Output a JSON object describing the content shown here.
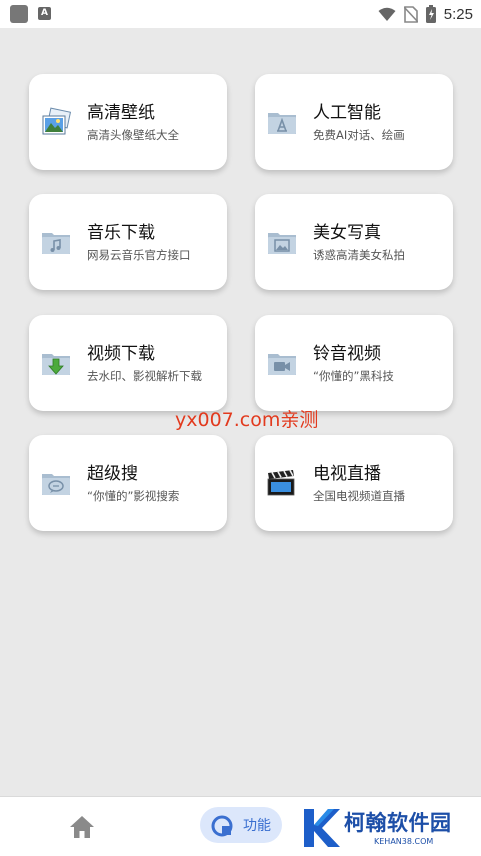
{
  "status_bar": {
    "time": "5:25",
    "icons": [
      "app-icon",
      "notification-a-icon",
      "wifi-icon",
      "no-sim-icon",
      "battery-icon"
    ],
    "notification_glyph": "A"
  },
  "cards": [
    {
      "title": "高清壁纸",
      "subtitle": "高清头像壁纸大全",
      "icon": "wallpaper-icon"
    },
    {
      "title": "人工智能",
      "subtitle": "免费AI对话、绘画",
      "icon": "app-folder-icon"
    },
    {
      "title": "音乐下载",
      "subtitle": "网易云音乐官方接口",
      "icon": "music-folder-icon"
    },
    {
      "title": "美女写真",
      "subtitle": "诱惑高清美女私拍",
      "icon": "picture-folder-icon"
    },
    {
      "title": "视频下载",
      "subtitle": "去水印、影视解析下载",
      "icon": "download-folder-icon"
    },
    {
      "title": "铃音视频",
      "subtitle": "“你懂的”黑科技",
      "icon": "video-folder-icon"
    },
    {
      "title": "超级搜",
      "subtitle": "“你懂的”影视搜索",
      "icon": "chat-folder-icon"
    },
    {
      "title": "电视直播",
      "subtitle": "全国电视频道直播",
      "icon": "clapperboard-icon"
    }
  ],
  "watermark": "yx007.com亲测",
  "bottom_nav": {
    "home_icon": "home-icon",
    "function_label": "功能",
    "brand_name": "柯翰软件园",
    "brand_url": "KEHAN38.COM"
  },
  "colors": {
    "background": "#e9e9e9",
    "card": "#ffffff",
    "watermark": "#e23a1e",
    "pill": "#dce7fb",
    "pill_text": "#3a6fd0",
    "brand": "#1d4fa8"
  }
}
